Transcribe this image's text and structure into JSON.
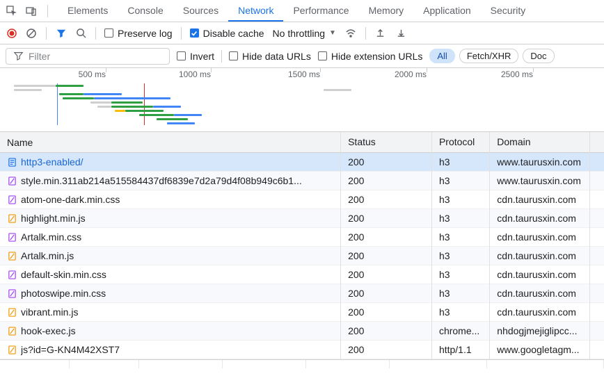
{
  "mainTabs": {
    "items": [
      {
        "label": "Elements",
        "active": false
      },
      {
        "label": "Console",
        "active": false
      },
      {
        "label": "Sources",
        "active": false
      },
      {
        "label": "Network",
        "active": true
      },
      {
        "label": "Performance",
        "active": false
      },
      {
        "label": "Memory",
        "active": false
      },
      {
        "label": "Application",
        "active": false
      },
      {
        "label": "Security",
        "active": false
      }
    ]
  },
  "toolbar": {
    "preserve_log_label": "Preserve log",
    "preserve_log_checked": false,
    "disable_cache_label": "Disable cache",
    "disable_cache_checked": true,
    "throttling_label": "No throttling"
  },
  "filterBar": {
    "filter_placeholder": "Filter",
    "invert_label": "Invert",
    "hide_data_urls_label": "Hide data URLs",
    "hide_ext_urls_label": "Hide extension URLs",
    "chips": [
      {
        "label": "All",
        "active": true
      },
      {
        "label": "Fetch/XHR",
        "active": false
      },
      {
        "label": "Doc",
        "active": false
      }
    ]
  },
  "timeline": {
    "labels": [
      "500 ms",
      "1000 ms",
      "1500 ms",
      "2000 ms",
      "2500 ms"
    ]
  },
  "table": {
    "headers": {
      "name": "Name",
      "status": "Status",
      "protocol": "Protocol",
      "domain": "Domain"
    },
    "rows": [
      {
        "icon": "doc",
        "name": "http3-enabled/",
        "link": true,
        "status": "200",
        "protocol": "h3",
        "domain": "www.taurusxin.com",
        "selected": true
      },
      {
        "icon": "css",
        "name": "style.min.311ab214a515584437df6839e7d2a79d4f08b949c6b1...",
        "status": "200",
        "protocol": "h3",
        "domain": "www.taurusxin.com"
      },
      {
        "icon": "css",
        "name": "atom-one-dark.min.css",
        "status": "200",
        "protocol": "h3",
        "domain": "cdn.taurusxin.com"
      },
      {
        "icon": "js",
        "name": "highlight.min.js",
        "status": "200",
        "protocol": "h3",
        "domain": "cdn.taurusxin.com"
      },
      {
        "icon": "css",
        "name": "Artalk.min.css",
        "status": "200",
        "protocol": "h3",
        "domain": "cdn.taurusxin.com"
      },
      {
        "icon": "js",
        "name": "Artalk.min.js",
        "status": "200",
        "protocol": "h3",
        "domain": "cdn.taurusxin.com"
      },
      {
        "icon": "css",
        "name": "default-skin.min.css",
        "status": "200",
        "protocol": "h3",
        "domain": "cdn.taurusxin.com"
      },
      {
        "icon": "css",
        "name": "photoswipe.min.css",
        "status": "200",
        "protocol": "h3",
        "domain": "cdn.taurusxin.com"
      },
      {
        "icon": "js",
        "name": "vibrant.min.js",
        "status": "200",
        "protocol": "h3",
        "domain": "cdn.taurusxin.com"
      },
      {
        "icon": "js",
        "name": "hook-exec.js",
        "status": "200",
        "protocol": "chrome...",
        "domain": "nhdogjmejiglipcc..."
      },
      {
        "icon": "js",
        "name": "js?id=G-KN4M42XST7",
        "status": "200",
        "protocol": "http/1.1",
        "domain": "www.googletagm..."
      }
    ]
  }
}
